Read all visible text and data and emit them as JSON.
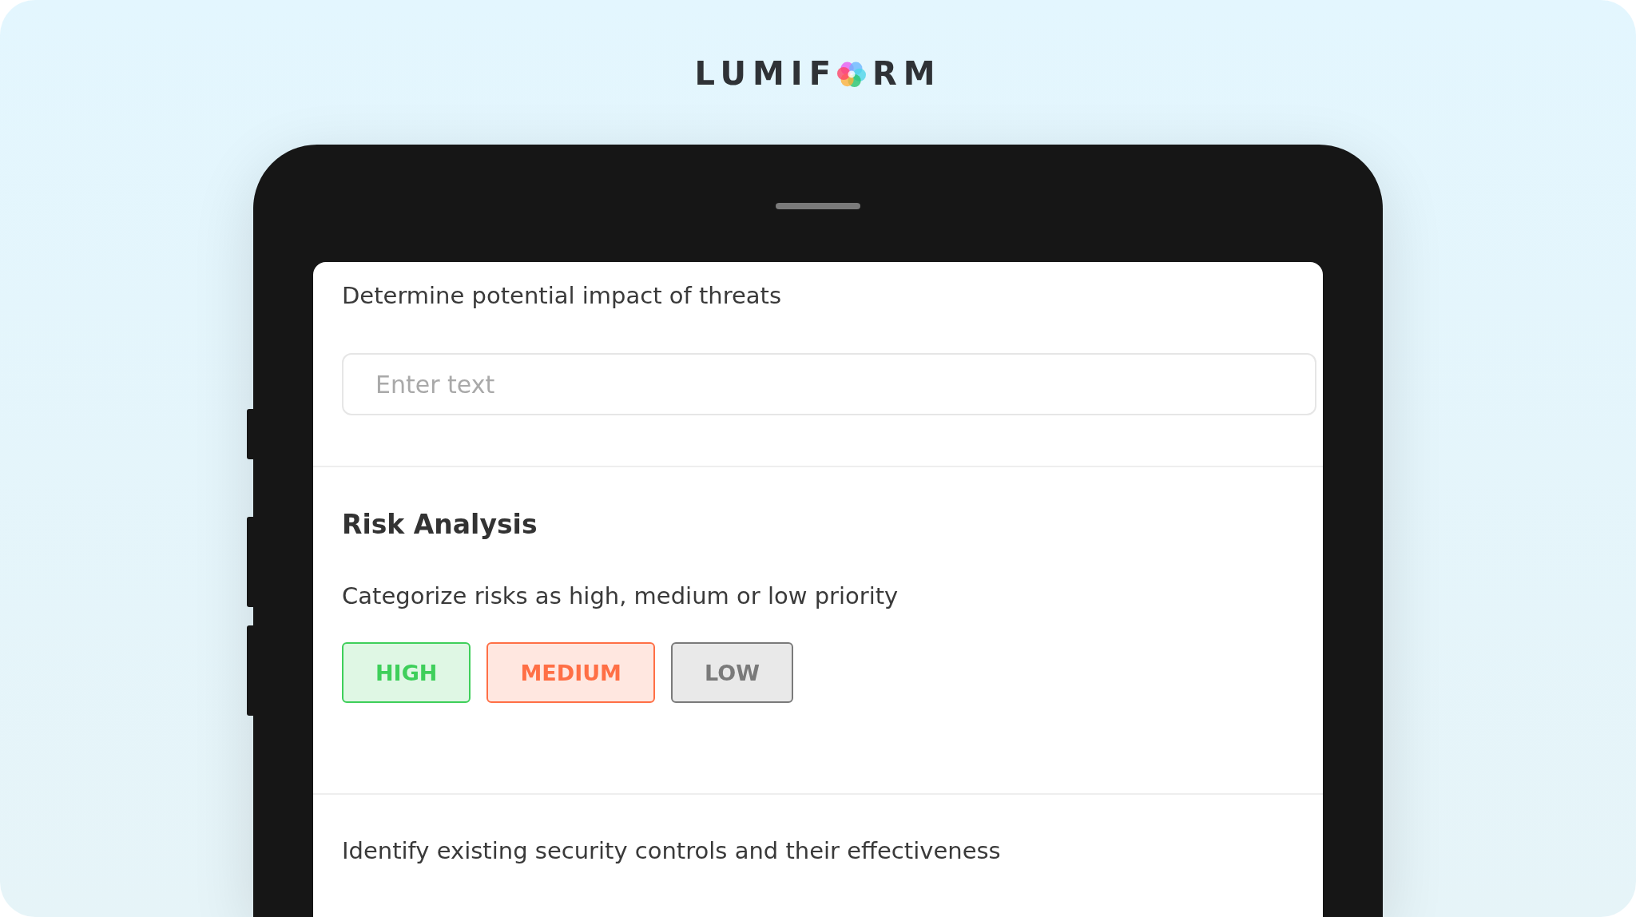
{
  "logo": {
    "before": "LUMIF",
    "after": "RM"
  },
  "form": {
    "question_1": "Determine potential impact of threats",
    "input": {
      "placeholder": "Enter text"
    },
    "section_title": "Risk Analysis",
    "question_2": "Categorize risks as high, medium or low priority",
    "options": [
      {
        "label": "HIGH",
        "color": "#3ecf5a"
      },
      {
        "label": "MEDIUM",
        "color": "#ff6f45"
      },
      {
        "label": "LOW",
        "color": "#7a7a7a"
      }
    ],
    "question_3": "Identify existing security controls and their effectiveness"
  }
}
